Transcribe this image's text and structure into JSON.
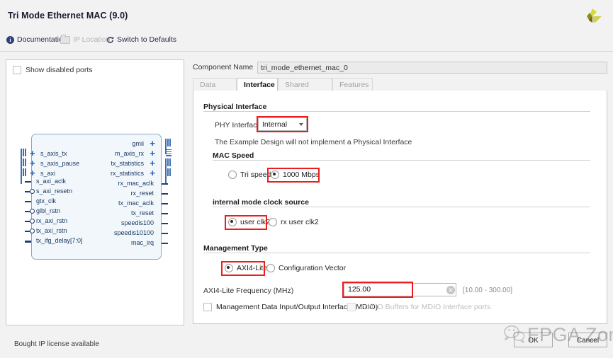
{
  "window": {
    "title": "Tri Mode Ethernet MAC (9.0)",
    "logo_icon": "xilinx-logo"
  },
  "toolbar": {
    "documentation": "Documentation",
    "documentation_icon": "info-icon",
    "ip_location": "IP Location",
    "ip_location_icon": "folder-icon",
    "switch_to_defaults": "Switch to Defaults",
    "switch_to_defaults_icon": "refresh-icon"
  },
  "left_panel": {
    "show_disabled_ports": "Show disabled ports",
    "show_disabled_checked": false,
    "block": {
      "left_ports": [
        {
          "label": "s_axis_tx",
          "kind": "bus"
        },
        {
          "label": "s_axis_pause",
          "kind": "bus"
        },
        {
          "label": "s_axi",
          "kind": "bus"
        },
        {
          "label": "s_axi_aclk",
          "kind": "wire"
        },
        {
          "label": "s_axi_resetn",
          "kind": "bubble"
        },
        {
          "label": "gtx_clk",
          "kind": "wire"
        },
        {
          "label": "glbl_rstn",
          "kind": "bubble"
        },
        {
          "label": "rx_axi_rstn",
          "kind": "bubble"
        },
        {
          "label": "tx_axi_rstn",
          "kind": "bubble"
        },
        {
          "label": "tx_ifg_delay[7:0]",
          "kind": "thick"
        }
      ],
      "right_ports": [
        {
          "label": "gmii",
          "kind": "bus"
        },
        {
          "label": "m_axis_rx",
          "kind": "bus"
        },
        {
          "label": "tx_statistics",
          "kind": "bus"
        },
        {
          "label": "rx_statistics",
          "kind": "bus"
        },
        {
          "label": "rx_mac_aclk",
          "kind": "wire"
        },
        {
          "label": "rx_reset",
          "kind": "wire"
        },
        {
          "label": "tx_mac_aclk",
          "kind": "wire"
        },
        {
          "label": "tx_reset",
          "kind": "wire"
        },
        {
          "label": "speedis100",
          "kind": "wire"
        },
        {
          "label": "speedis10100",
          "kind": "wire"
        },
        {
          "label": "mac_irq",
          "kind": "wire"
        }
      ]
    }
  },
  "right_panel": {
    "component_name_label": "Component Name",
    "component_name_value": "tri_mode_ethernet_mac_0",
    "tabs": [
      {
        "label": "Data Rate",
        "active": false
      },
      {
        "label": "Interface",
        "active": true
      },
      {
        "label": "Shared Logic",
        "active": false
      },
      {
        "label": "Features",
        "active": false
      }
    ],
    "physical_interface": {
      "title": "Physical Interface",
      "phy_label": "PHY Interface",
      "phy_value": "Internal",
      "note": "The Example Design will not implement a Physical Interface"
    },
    "mac_speed": {
      "title": "MAC Speed",
      "option_tri": "Tri speed",
      "option_1000": "1000 Mbps",
      "selected": "1000 Mbps"
    },
    "clock_source": {
      "title": "internal mode clock source",
      "option_user": "user clk2",
      "option_rx_user": "rx user clk2",
      "selected": "user clk2"
    },
    "management_type": {
      "title": "Management Type",
      "option_axi": "AXI4-Lite",
      "option_cfgvec": "Configuration Vector",
      "selected": "AXI4-Lite",
      "freq_label": "AXI4-Lite Frequency (MHz)",
      "freq_value": "125.00",
      "freq_range": "[10.00 - 300.00]",
      "clear_icon": "clear-icon",
      "mdio_label": "Management Data Input/Output Interface (MDIO)",
      "mdio_checked": false,
      "mdio_buffers_label": "Add IO Buffers for MDIO Interface ports",
      "mdio_buffers_checked": false
    }
  },
  "footer": {
    "license_status": "Bought IP license available",
    "ok": "OK",
    "cancel": "Cancel"
  },
  "watermark": {
    "text": "FPGA Zone",
    "icon": "wechat-icon"
  },
  "colors": {
    "highlight": "#ee1c1c",
    "block_fill": "#f2f7fc",
    "block_border": "#8aa7c7",
    "port_text": "#16355e",
    "window_bg": "#f2f2f2"
  }
}
